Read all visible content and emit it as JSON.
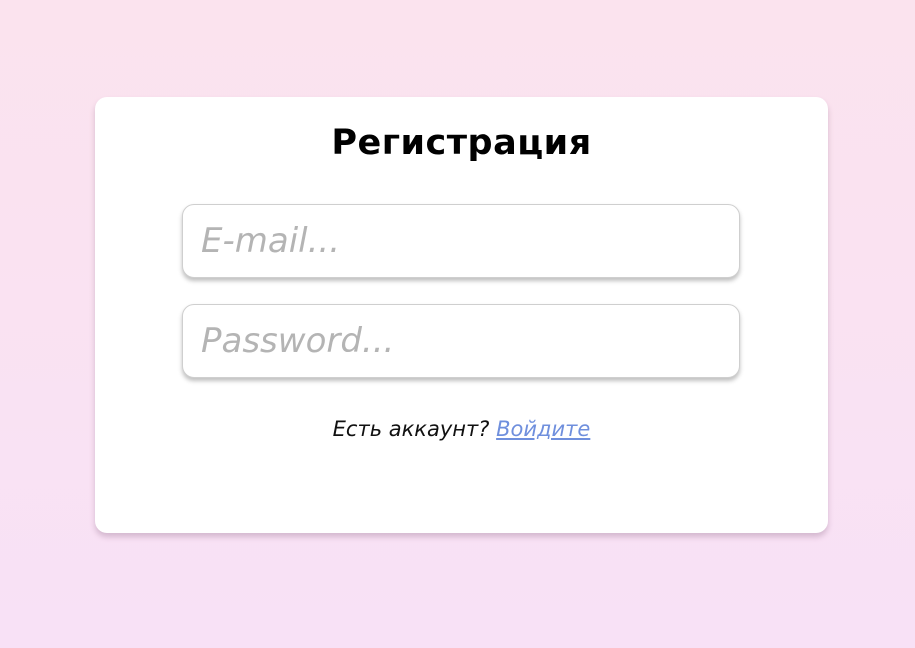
{
  "form": {
    "title": "Регистрация",
    "email": {
      "placeholder": "E-mail...",
      "value": ""
    },
    "password": {
      "placeholder": "Password...",
      "value": ""
    },
    "account_prompt": "Есть аккаунт?",
    "login_link": "Войдите"
  },
  "colors": {
    "background_top": "#fbe3ee",
    "background_bottom": "#f8e1f6",
    "card": "#ffffff",
    "link": "#6f8fdd",
    "placeholder": "#b4b4b4"
  }
}
